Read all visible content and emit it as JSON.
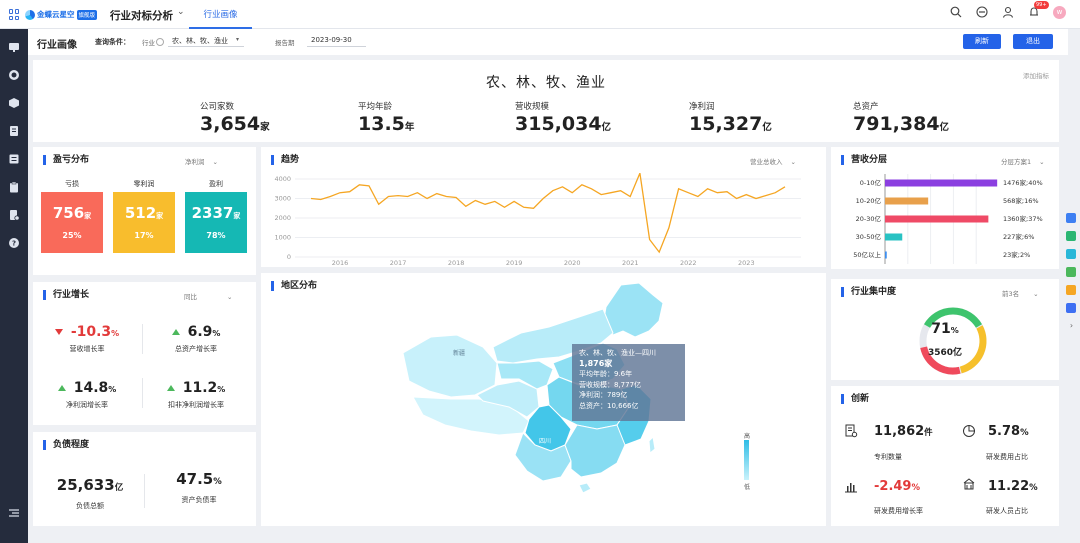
{
  "app": {
    "logo_text": "金蝶云星空",
    "logo_badge": "旗舰版",
    "title": "行业对标分析",
    "active_tab": "行业画像",
    "notification_count": "99+",
    "avatar_initial": "w"
  },
  "query": {
    "page_title": "行业画像",
    "condition_label": "查询条件：",
    "industry_label": "行业",
    "industry_value": "农、林、牧、渔业",
    "period_label": "报告期",
    "period_value": "2023-09-30",
    "refresh_label": "刷新",
    "exit_label": "退出"
  },
  "summary": {
    "industry_name": "农、林、牧、渔业",
    "add_indicator": "添加指标",
    "kpis": [
      {
        "label": "公司家数",
        "value": "3,654",
        "unit": "家"
      },
      {
        "label": "平均年龄",
        "value": "13.5",
        "unit": "年"
      },
      {
        "label": "营收规模",
        "value": "315,034",
        "unit": "亿"
      },
      {
        "label": "净利润",
        "value": "15,327",
        "unit": "亿"
      },
      {
        "label": "总资产",
        "value": "791,384",
        "unit": "亿"
      }
    ]
  },
  "profit": {
    "title": "盈亏分布",
    "selector": "净利润",
    "items": [
      {
        "label": "亏损",
        "value": "756",
        "unit": "家",
        "pct": "25%",
        "color": "#f96a5a"
      },
      {
        "label": "零利润",
        "value": "512",
        "unit": "家",
        "pct": "17%",
        "color": "#f8bd2d"
      },
      {
        "label": "盈利",
        "value": "2337",
        "unit": "家",
        "pct": "78%",
        "color": "#15b8b4"
      }
    ]
  },
  "trend": {
    "title": "趋势",
    "selector": "营业总收入",
    "line_color": "#f5a623"
  },
  "revenue_layers": {
    "title": "营收分层",
    "selector": "分层方案1"
  },
  "growth": {
    "title": "行业增长",
    "selector": "同比",
    "items": [
      {
        "value": "-10.3",
        "unit": "%",
        "label": "营收增长率",
        "dir": "down"
      },
      {
        "value": "6.9",
        "unit": "%",
        "label": "总资产增长率",
        "dir": "up"
      },
      {
        "value": "14.8",
        "unit": "%",
        "label": "净利润增长率",
        "dir": "up"
      },
      {
        "value": "11.2",
        "unit": "%",
        "label": "扣非净利润增长率",
        "dir": "up"
      }
    ]
  },
  "map": {
    "title": "地区分布",
    "legend_high": "高",
    "legend_low": "低",
    "labels": {
      "xinjiang": "新疆",
      "sichuan": "四川"
    },
    "tooltip": {
      "header": "农、林、牧、渔业—四川",
      "count": "1,876家",
      "avg_age": "平均年龄：9.6年",
      "revenue": "营收规模：8,777亿",
      "net_profit": "净利润：789亿",
      "assets": "总资产：10,666亿"
    }
  },
  "concentration": {
    "title": "行业集中度",
    "selector": "前3名",
    "value": "71",
    "unit": "%",
    "amount": "3560亿",
    "ring_colors": [
      "#3ec46d",
      "#f6c02b",
      "#ef4a5c",
      "#e6e8ee"
    ]
  },
  "debt": {
    "title": "负债程度",
    "items": [
      {
        "value": "25,633",
        "unit": "亿",
        "label": "负债总额"
      },
      {
        "value": "47.5",
        "unit": "%",
        "label": "资产负债率"
      }
    ]
  },
  "innovation": {
    "title": "创新",
    "items": [
      {
        "value": "11,862",
        "unit": "件",
        "label": "专利数量",
        "icon": "patent-icon"
      },
      {
        "value": "5.78",
        "unit": "%",
        "label": "研发费用占比",
        "icon": "pie-icon"
      },
      {
        "value": "-2.49",
        "unit": "%",
        "label": "研发费用增长率",
        "icon": "bar-chart-icon"
      },
      {
        "value": "11.22",
        "unit": "%",
        "label": "研发人员占比",
        "icon": "people-icon"
      }
    ]
  },
  "chart_data": [
    {
      "type": "line",
      "title": "趋势",
      "x_ticks": [
        "2016",
        "2017",
        "2018",
        "2019",
        "2020",
        "2021",
        "2022",
        "2023"
      ],
      "ylim": [
        0,
        4000
      ],
      "y_ticks": [
        0,
        1000,
        2000,
        3000,
        4000
      ],
      "grid": true,
      "x": [
        "2015-07",
        "2015-09",
        "2015-11",
        "2016-01",
        "2016-03",
        "2016-05",
        "2016-07",
        "2016-09",
        "2016-11",
        "2017-01",
        "2017-03",
        "2017-05",
        "2017-07",
        "2017-09",
        "2017-11",
        "2018-01",
        "2018-03",
        "2018-05",
        "2018-07",
        "2018-09",
        "2018-11",
        "2019-01",
        "2019-03",
        "2019-05",
        "2019-07",
        "2019-09",
        "2019-11",
        "2020-01",
        "2020-03",
        "2020-05",
        "2020-07",
        "2020-09",
        "2020-11",
        "2021-01",
        "2021-03",
        "2021-05",
        "2021-07",
        "2021-09",
        "2021-11",
        "2022-01",
        "2022-03",
        "2022-05",
        "2022-07",
        "2022-09",
        "2022-11",
        "2023-01",
        "2023-03",
        "2023-05",
        "2023-07",
        "2023-09"
      ],
      "series": [
        {
          "values": [
            3000,
            2950,
            3100,
            3300,
            3350,
            3700,
            3650,
            2700,
            3100,
            3150,
            3100,
            3300,
            3000,
            3250,
            3100,
            3050,
            2600,
            2900,
            2700,
            2850,
            2550,
            2850,
            2550,
            2500,
            3000,
            3400,
            3600,
            3300,
            3700,
            3500,
            3200,
            3300,
            3400,
            3100,
            4300,
            900,
            250,
            1500,
            3500,
            3300,
            3100,
            3500,
            3300,
            3350,
            3000,
            3200,
            3000,
            3150,
            3300,
            3600
          ]
        }
      ]
    },
    {
      "type": "bar",
      "title": "营收分层",
      "categories": [
        "0-10亿",
        "10-20亿",
        "20-30亿",
        "30-50亿",
        "50亿以上"
      ],
      "values": [
        1476,
        568,
        1360,
        227,
        23
      ],
      "data_labels": [
        "1476家;40%",
        "568家;16%",
        "1360家;37%",
        "227家;6%",
        "23家;2%"
      ],
      "colors": [
        "#8b3fe0",
        "#e8a04b",
        "#ef4a66",
        "#29c2c3",
        "#3d8ff0"
      ],
      "xlim": [
        0,
        1500
      ],
      "x_ticks": [
        0,
        300,
        600,
        900,
        1200
      ]
    }
  ]
}
